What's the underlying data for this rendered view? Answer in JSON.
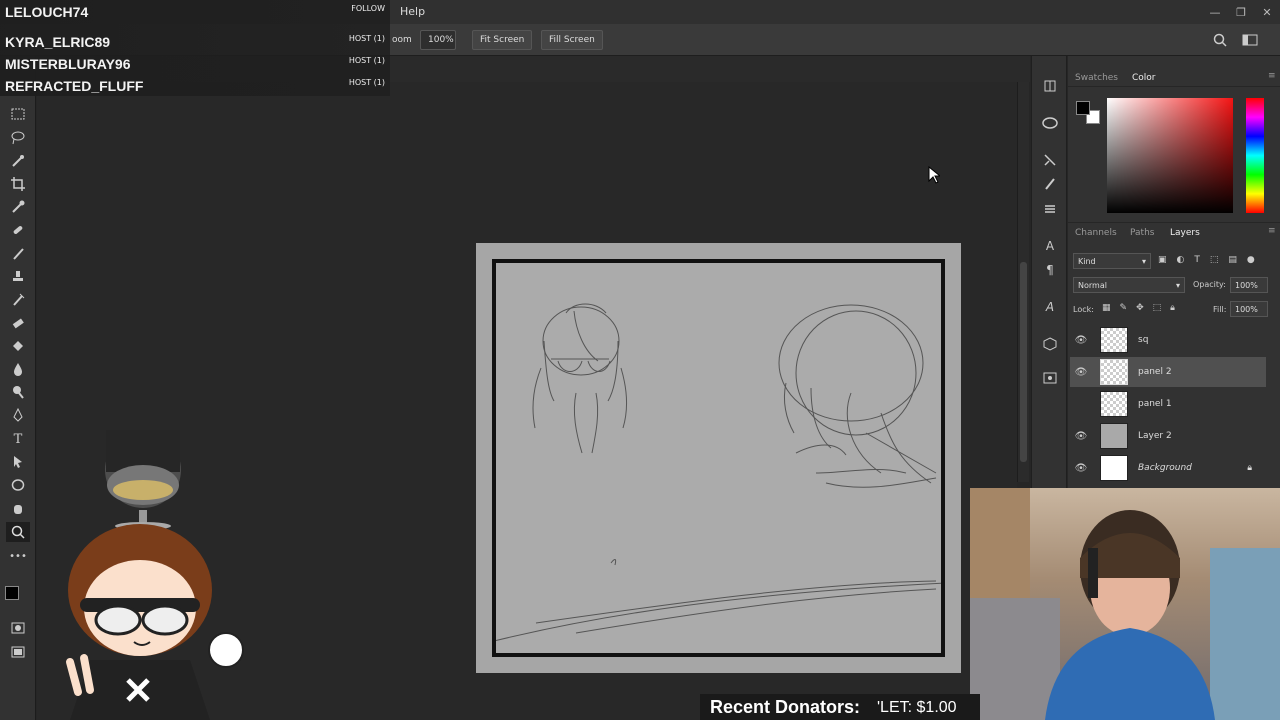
{
  "menubar": {
    "help": "Help"
  },
  "window_controls": {
    "minimize": "—",
    "maximize": "❐",
    "close": "✕"
  },
  "options_bar": {
    "zoom_fragment": "oom",
    "zoom_value": "100%",
    "fit_screen": "Fit Screen",
    "fill_screen": "Fill Screen",
    "search_icon": "search-icon",
    "workspace_icon": "workspace-icon"
  },
  "chat": [
    {
      "user": "LELOUCH74",
      "event": "FOLLOW"
    },
    {
      "user": "KYRA_ELRIC89",
      "event": "HOST (1)"
    },
    {
      "user": "MISTERBLURAY96",
      "event": "HOST (1)"
    },
    {
      "user": "REFRACTED_FLUFF",
      "event": "HOST (1)"
    }
  ],
  "color_panel": {
    "tabs": [
      "Swatches",
      "Color"
    ],
    "active_tab": "Color",
    "foreground": "#000000",
    "background": "#ffffff",
    "picked_hue": "#f41414"
  },
  "layers_panel": {
    "tabs": [
      "Channels",
      "Paths",
      "Layers"
    ],
    "active_tab": "Layers",
    "filter_kind": "Kind",
    "blend_mode": "Normal",
    "opacity_label": "Opacity:",
    "opacity_value": "100%",
    "lock_label": "Lock:",
    "fill_label": "Fill:",
    "fill_value": "100%",
    "layers": [
      {
        "name": "sq",
        "visible": true,
        "selected": false,
        "thumb": "transparent"
      },
      {
        "name": "panel 2",
        "visible": true,
        "selected": true,
        "thumb": "transparent"
      },
      {
        "name": "panel 1",
        "visible": false,
        "selected": false,
        "thumb": "transparent"
      },
      {
        "name": "Layer 2",
        "visible": true,
        "selected": false,
        "thumb": "gray"
      },
      {
        "name": "Background",
        "visible": true,
        "selected": false,
        "thumb": "white",
        "locked": true
      }
    ]
  },
  "donators": {
    "label": "Recent Donators:",
    "ticker": "'LET: $1.00"
  },
  "colors": {
    "accent": "#f41414",
    "panel_bg": "#323232",
    "canvas_bg": "#282828"
  }
}
